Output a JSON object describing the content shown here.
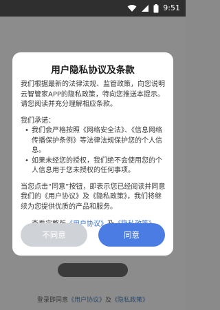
{
  "status_bar": {
    "time": "9:51",
    "icons": [
      "wifi-icon",
      "signal-icon",
      "battery-icon"
    ]
  },
  "background": {
    "login_prefix": "登录即同意",
    "user_agreement": "《用户协议》",
    "and": "及",
    "privacy_policy": "《隐私政策》"
  },
  "dialog": {
    "title": "用户隐私协议及条款",
    "intro": "我们根据最新的法律法规、监管政策，向您说明云智管家APP的隐私政策，特向您推送本提示。请您阅读并充分理解相应条款。",
    "promise_heading": "我们承诺：",
    "bullets": [
      "我们会严格按照《网络安全法》、《信息网络传播保护条例》等法律法规保护您的个人信息。",
      "如果未经您的授权，我们绝不会使用您的个人信息用于您未授权的任何事项。"
    ],
    "consent_text": "当您点击“同意”按钮，即表示您已经阅读并同意我们的《用户协议》及《隐私政策》，我们将继续为您提供优质的产品和服务。",
    "view_prefix": "查看完整版",
    "user_agreement_link": "《用户协议》",
    "and": "及",
    "privacy_policy_link": "《隐私政策》",
    "disagree_label": "不同意",
    "agree_label": "同意"
  },
  "colors": {
    "accent": "#4b7ce3",
    "link": "#3b74d6",
    "disagree_bg": "#cfd2d6",
    "overlay": "#8c8c8c"
  }
}
